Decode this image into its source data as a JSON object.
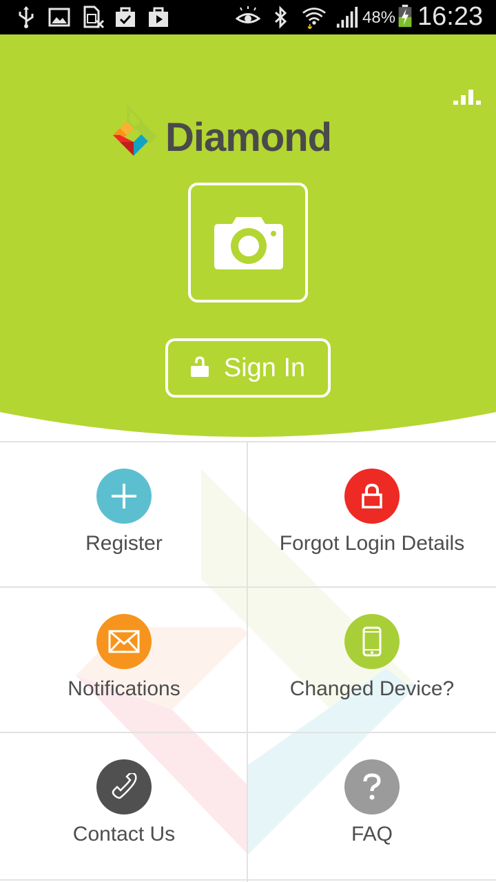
{
  "status_bar": {
    "battery_percent": "48%",
    "time": "16:23"
  },
  "brand": {
    "name": "Diamond",
    "primary_color": "#b3d632",
    "text_color": "#4a4a4a"
  },
  "header": {
    "signin_label": "Sign In"
  },
  "menu": {
    "items": [
      {
        "label": "Register",
        "icon": "plus-icon",
        "color": "#5cbfd0"
      },
      {
        "label": "Forgot Login Details",
        "icon": "lock-icon",
        "color": "#ee2a24"
      },
      {
        "label": "Notifications",
        "icon": "envelope-icon",
        "color": "#f7941d"
      },
      {
        "label": "Changed Device?",
        "icon": "phone-icon",
        "color": "#a9cf38"
      },
      {
        "label": "Contact Us",
        "icon": "handset-icon",
        "color": "#505050"
      },
      {
        "label": "FAQ",
        "icon": "question-icon",
        "color": "#9b9b9b"
      }
    ]
  }
}
